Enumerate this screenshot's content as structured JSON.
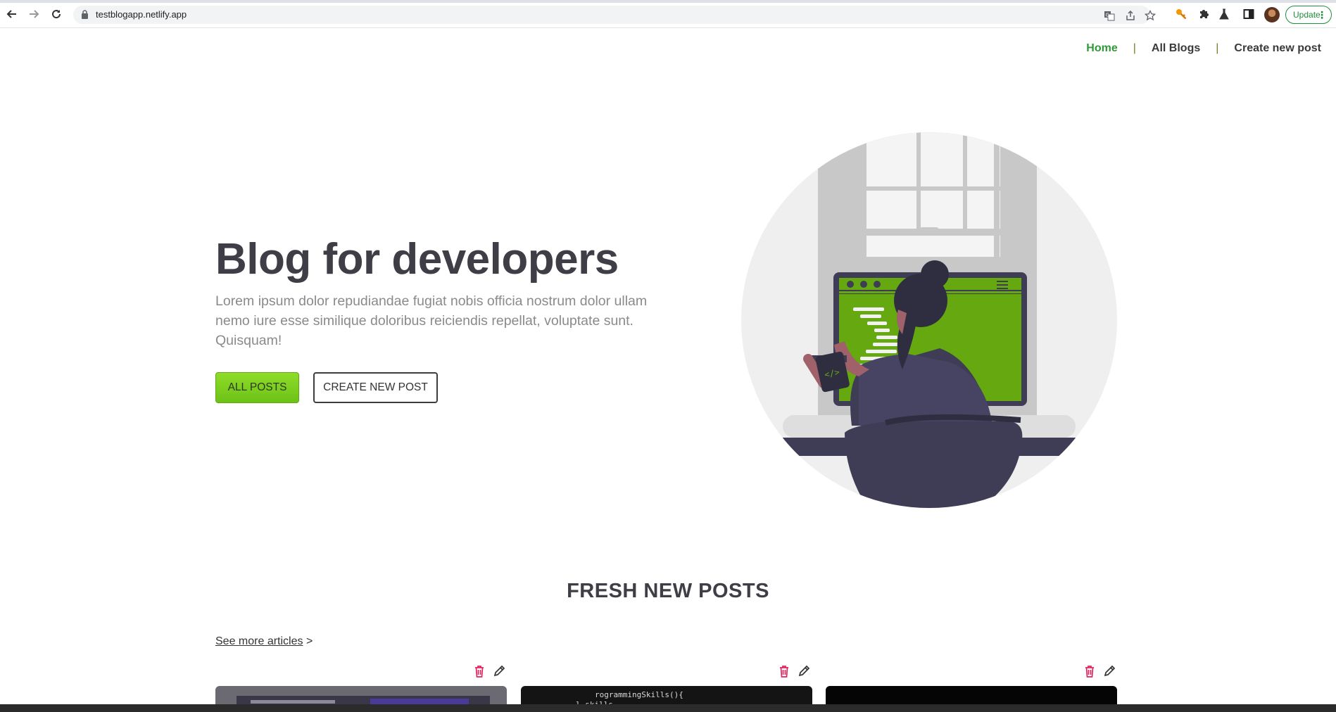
{
  "browser": {
    "url": "testblogapp.netlify.app",
    "update_label": "Update",
    "icons": [
      "back-arrow-icon",
      "forward-arrow-icon",
      "reload-icon",
      "lock-icon",
      "translate-icon",
      "share-icon",
      "bookmark-star-icon",
      "extension-key-icon",
      "extensions-puzzle-icon",
      "labs-flask-icon",
      "side-panel-icon",
      "profile-avatar",
      "menu-dots-icon"
    ]
  },
  "nav": {
    "home": "Home",
    "all_blogs": "All Blogs",
    "create": "Create new post",
    "separator": "|"
  },
  "hero": {
    "title": "Blog for developers",
    "text": "Lorem ipsum dolor repudiandae fugiat nobis officia nostrum dolor ullam nemo iure esse similique doloribus reiciendis repellat, voluptate sunt. Quisquam!",
    "btn_all": "ALL POSTS",
    "btn_create": "CREATE NEW POST"
  },
  "posts": {
    "title": "FRESH NEW POSTS",
    "see_more": "See more articles",
    "see_more_arrow": ">",
    "card_code_text_1": "rogrammingSkills(){",
    "card_code_text_2": "l.skills"
  },
  "colors": {
    "accent_green": "#6dc216",
    "active_nav": "#2f9a3a",
    "title_dark": "#3f3d45",
    "delete_red": "#e0245e"
  }
}
